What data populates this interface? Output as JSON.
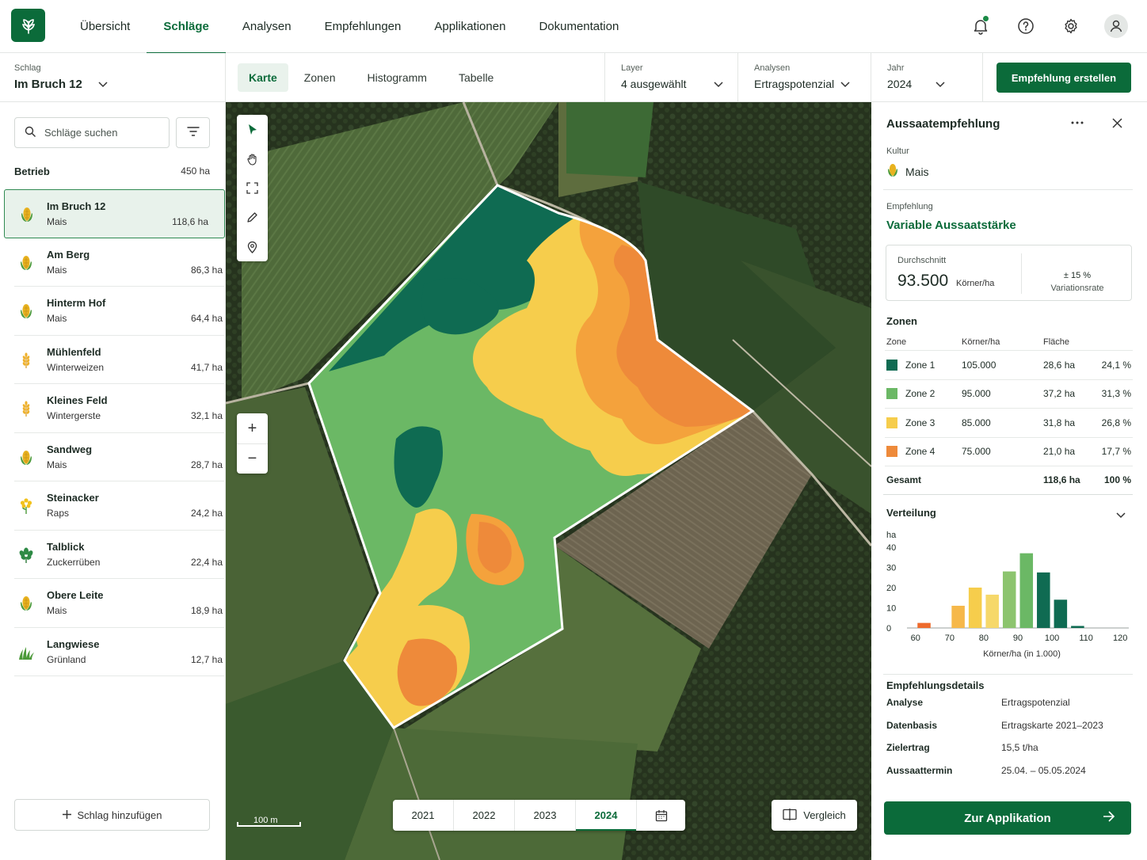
{
  "nav": {
    "items": [
      {
        "label": "Übersicht",
        "active": false
      },
      {
        "label": "Schläge",
        "active": true
      },
      {
        "label": "Analysen",
        "active": false
      },
      {
        "label": "Empfehlungen",
        "active": false
      },
      {
        "label": "Applikationen",
        "active": false
      },
      {
        "label": "Dokumentation",
        "active": false
      }
    ],
    "icons": [
      "bell-icon",
      "help-icon",
      "gear-icon",
      "user-icon"
    ]
  },
  "field_selector": {
    "label": "Schlag",
    "value": "Im Bruch 12"
  },
  "view_tabs": [
    {
      "label": "Karte",
      "active": true
    },
    {
      "label": "Zonen",
      "active": false
    },
    {
      "label": "Histogramm",
      "active": false
    },
    {
      "label": "Tabelle",
      "active": false
    }
  ],
  "layer_select": {
    "label": "Layer",
    "value": "4 ausgewählt"
  },
  "analysis_select": {
    "label": "Analysen",
    "value": "Ertragspotenzial"
  },
  "year_select": {
    "label": "Jahr",
    "value": "2024"
  },
  "create_button": "Empfehlung erstellen",
  "sidebar": {
    "search_placeholder": "Schläge suchen",
    "group": {
      "name": "Betrieb",
      "area": "450 ha"
    },
    "fields": [
      {
        "name": "Im Bruch 12",
        "crop": "Mais",
        "area": "118,6 ha",
        "icon": "corn-icon",
        "active": true
      },
      {
        "name": "Am Berg",
        "crop": "Mais",
        "area": "86,3 ha",
        "icon": "corn-icon",
        "active": false
      },
      {
        "name": "Hinterm Hof",
        "crop": "Mais",
        "area": "64,4 ha",
        "icon": "corn-icon",
        "active": false
      },
      {
        "name": "Mühlenfeld",
        "crop": "Winterweizen",
        "area": "41,7 ha",
        "icon": "wheat-icon",
        "active": false
      },
      {
        "name": "Kleines Feld",
        "crop": "Wintergerste",
        "area": "32,1 ha",
        "icon": "wheat-icon",
        "active": false
      },
      {
        "name": "Sandweg",
        "crop": "Mais",
        "area": "28,7 ha",
        "icon": "corn-icon",
        "active": false
      },
      {
        "name": "Steinacker",
        "crop": "Raps",
        "area": "24,2 ha",
        "icon": "rapeseed-icon",
        "active": false
      },
      {
        "name": "Talblick",
        "crop": "Zuckerrüben",
        "area": "22,4 ha",
        "icon": "beet-icon",
        "active": false
      },
      {
        "name": "Obere Leite",
        "crop": "Mais",
        "area": "18,9 ha",
        "icon": "corn-icon",
        "active": false
      },
      {
        "name": "Langwiese",
        "crop": "Grünland",
        "area": "12,7 ha",
        "icon": "grass-icon",
        "active": false
      }
    ],
    "add_button": "Schlag hinzufügen"
  },
  "map": {
    "tools": [
      "select-arrow-icon",
      "hand-icon",
      "fullscreen-icon",
      "pencil-icon",
      "location-pin-icon"
    ],
    "zoom_in": "+",
    "zoom_out": "−",
    "scale_label": "100 m",
    "years": [
      {
        "label": "2021",
        "active": false
      },
      {
        "label": "2022",
        "active": false
      },
      {
        "label": "2023",
        "active": false
      },
      {
        "label": "2024",
        "active": true
      }
    ],
    "compare_label": "Vergleich"
  },
  "panel": {
    "title": "Aussaatempfehlung",
    "crop_label": "Kultur",
    "crop": "Mais",
    "recommendation_label": "Empfehlung",
    "recommendation": "Variable Aussaatstärke",
    "average_label": "Durchschnitt",
    "average_value": "93.500",
    "average_unit": "Körner/ha",
    "variation_value": "± 15 %",
    "variation_label": "Variationsrate",
    "zones_title": "Zonen",
    "zones_header": {
      "zone": "Zone",
      "rate": "Körner/ha",
      "area": "Fläche"
    },
    "zones": [
      {
        "name": "Zone 1",
        "rate": "105.000",
        "area": "28,6 ha",
        "share": "24,1 %",
        "color": "#0f6b52"
      },
      {
        "name": "Zone 2",
        "rate": "95.000",
        "area": "37,2 ha",
        "share": "31,3 %",
        "color": "#6bb865"
      },
      {
        "name": "Zone 3",
        "rate": "85.000",
        "area": "31,8 ha",
        "share": "26,8 %",
        "color": "#f6cd4c"
      },
      {
        "name": "Zone 4",
        "rate": "75.000",
        "area": "21,0 ha",
        "share": "17,7 %",
        "color": "#ee8a3a"
      }
    ],
    "total": {
      "label": "Gesamt",
      "area": "118,6 ha",
      "share": "100 %"
    },
    "distribution_title": "Verteilung",
    "details_title": "Empfehlungsdetails",
    "details": [
      {
        "key": "Analyse",
        "value": "Ertragspotenzial"
      },
      {
        "key": "Datenbasis",
        "value": "Ertragskarte 2021–2023"
      },
      {
        "key": "Zielertrag",
        "value": "15,5 t/ha"
      },
      {
        "key": "Aussaattermin",
        "value": "25.04. – 05.05.2024"
      }
    ],
    "apply_button": "Zur Applikation"
  },
  "chart_data": {
    "type": "bar",
    "ylabel": "ha",
    "xlabel": "Körner/ha (in 1.000)",
    "ylim": [
      0,
      40
    ],
    "yticks": [
      0,
      10,
      20,
      30,
      40
    ],
    "xticks": [
      60,
      70,
      80,
      90,
      100,
      110,
      120
    ],
    "bars": [
      {
        "x": 62.5,
        "y": 2.5,
        "color": "#ee6b2c"
      },
      {
        "x": 72.5,
        "y": 11,
        "color": "#f6b84a"
      },
      {
        "x": 77.5,
        "y": 20,
        "color": "#f6cd4c"
      },
      {
        "x": 82.5,
        "y": 16.5,
        "color": "#f6d86a"
      },
      {
        "x": 87.5,
        "y": 28,
        "color": "#8cc46e"
      },
      {
        "x": 92.5,
        "y": 37,
        "color": "#6bb865"
      },
      {
        "x": 97.5,
        "y": 27.5,
        "color": "#0f6b52"
      },
      {
        "x": 102.5,
        "y": 14,
        "color": "#0f6b52"
      },
      {
        "x": 107.5,
        "y": 1,
        "color": "#0f6b52"
      }
    ]
  }
}
